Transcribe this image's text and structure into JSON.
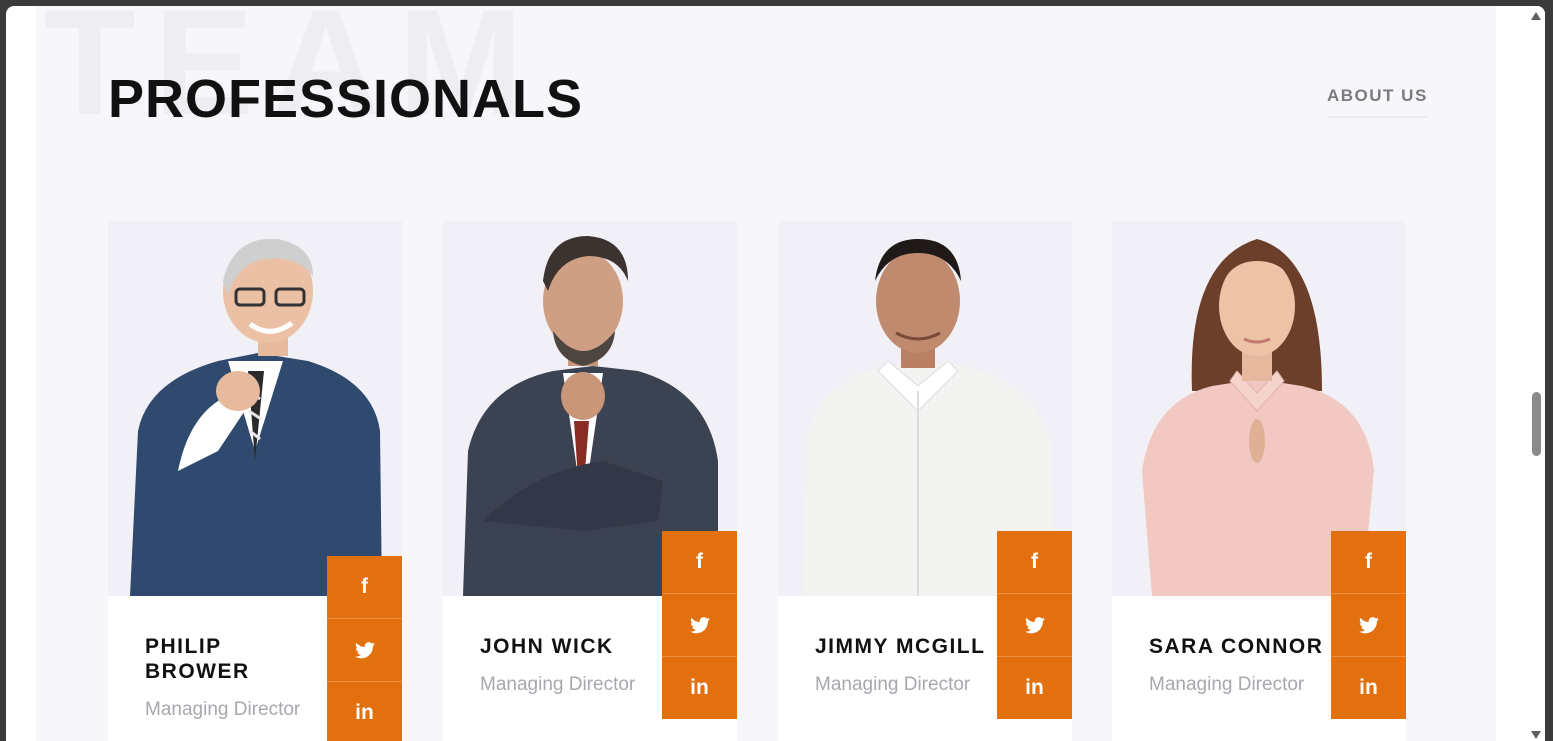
{
  "section": {
    "background_word": "TEAM",
    "title": "PROFESSIONALS",
    "about_link": "ABOUT US"
  },
  "social_icons": {
    "facebook": "f",
    "twitter": "twitter-bird",
    "linkedin": "in"
  },
  "colors": {
    "accent": "#e2700f",
    "title": "#111111",
    "role": "#a7a7ae",
    "photo_bg": "#f1f0f6"
  },
  "team": [
    {
      "name": "PHILIP BROWER",
      "role": "Managing Director"
    },
    {
      "name": "JOHN WICK",
      "role": "Managing Director"
    },
    {
      "name": "JIMMY MCGILL",
      "role": "Managing Director"
    },
    {
      "name": "SARA CONNOR",
      "role": "Managing Director"
    }
  ]
}
